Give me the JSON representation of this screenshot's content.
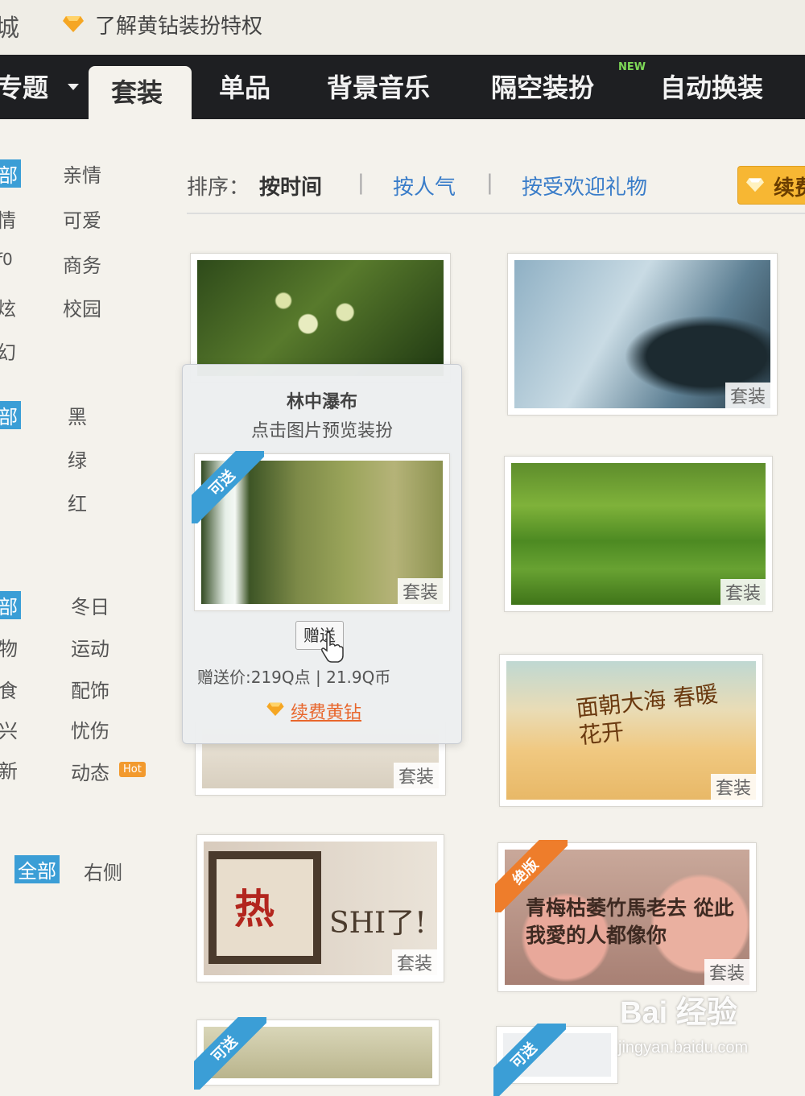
{
  "topbar": {
    "cut_text": "城",
    "privilege_link": "了解黄钻装扮特权"
  },
  "nav": {
    "items": [
      "专题",
      "套装",
      "单品",
      "背景音乐",
      "隔空装扮",
      "自动换装"
    ],
    "new_badge": "NEW"
  },
  "sidebar": {
    "group1_left": [
      "部",
      "情",
      "f0",
      "炫",
      "幻"
    ],
    "group1_right": [
      "亲情",
      "可爱",
      "商务",
      "校园"
    ],
    "group2_left": [
      "部"
    ],
    "group2_right": [
      "黑",
      "绿",
      "红"
    ],
    "group3_left": [
      "部",
      "物",
      "食",
      "兴",
      "新"
    ],
    "group3_right": [
      "冬日",
      "运动",
      "配饰",
      "忧伤",
      "动态"
    ],
    "hot_badge": "Hot",
    "group4": [
      "全部",
      "右侧"
    ]
  },
  "sort": {
    "label": "排序：",
    "by_time": "按时间",
    "by_popularity": "按人气",
    "by_gift": "按受欢迎礼物",
    "separator": "|"
  },
  "renew_button": "续费",
  "card_tag": "套装",
  "ribbons": {
    "giftable": "可送",
    "discontinued": "绝版"
  },
  "cards": [
    {
      "name": "flowers",
      "tag": "套装"
    },
    {
      "name": "winter-window",
      "tag": "套装"
    },
    {
      "name": "waterfall",
      "tag": "套装"
    },
    {
      "name": "green-field",
      "tag": "套装"
    },
    {
      "name": "partial-hidden",
      "tag": "套装"
    },
    {
      "name": "sea-flowers",
      "tag": "套装",
      "overlay": "面朝大海 春暖花开"
    },
    {
      "name": "hot-shi",
      "tag": "套装",
      "overlay_big": "热",
      "overlay_text": "SHI了!"
    },
    {
      "name": "roses",
      "tag": "套装",
      "overlay": "青梅枯萎竹馬老去 從此我愛的人都像你"
    }
  ],
  "popup": {
    "title": "林中瀑布",
    "hint": "点击图片预览装扮",
    "gift_button": "赠送",
    "price": "赠送价:219Q点 | 21.9Q币",
    "renew_link": "续费黄钻"
  },
  "watermark": {
    "brand": "Bai 经验",
    "url": "jingyan.baidu.com"
  },
  "colors": {
    "nav_bg": "#1e1f22",
    "link_blue": "#3a7dc9",
    "renew_orange": "#f7b733",
    "ribbon_blue": "#3b9ed6",
    "ribbon_orange": "#ee7d2b"
  }
}
